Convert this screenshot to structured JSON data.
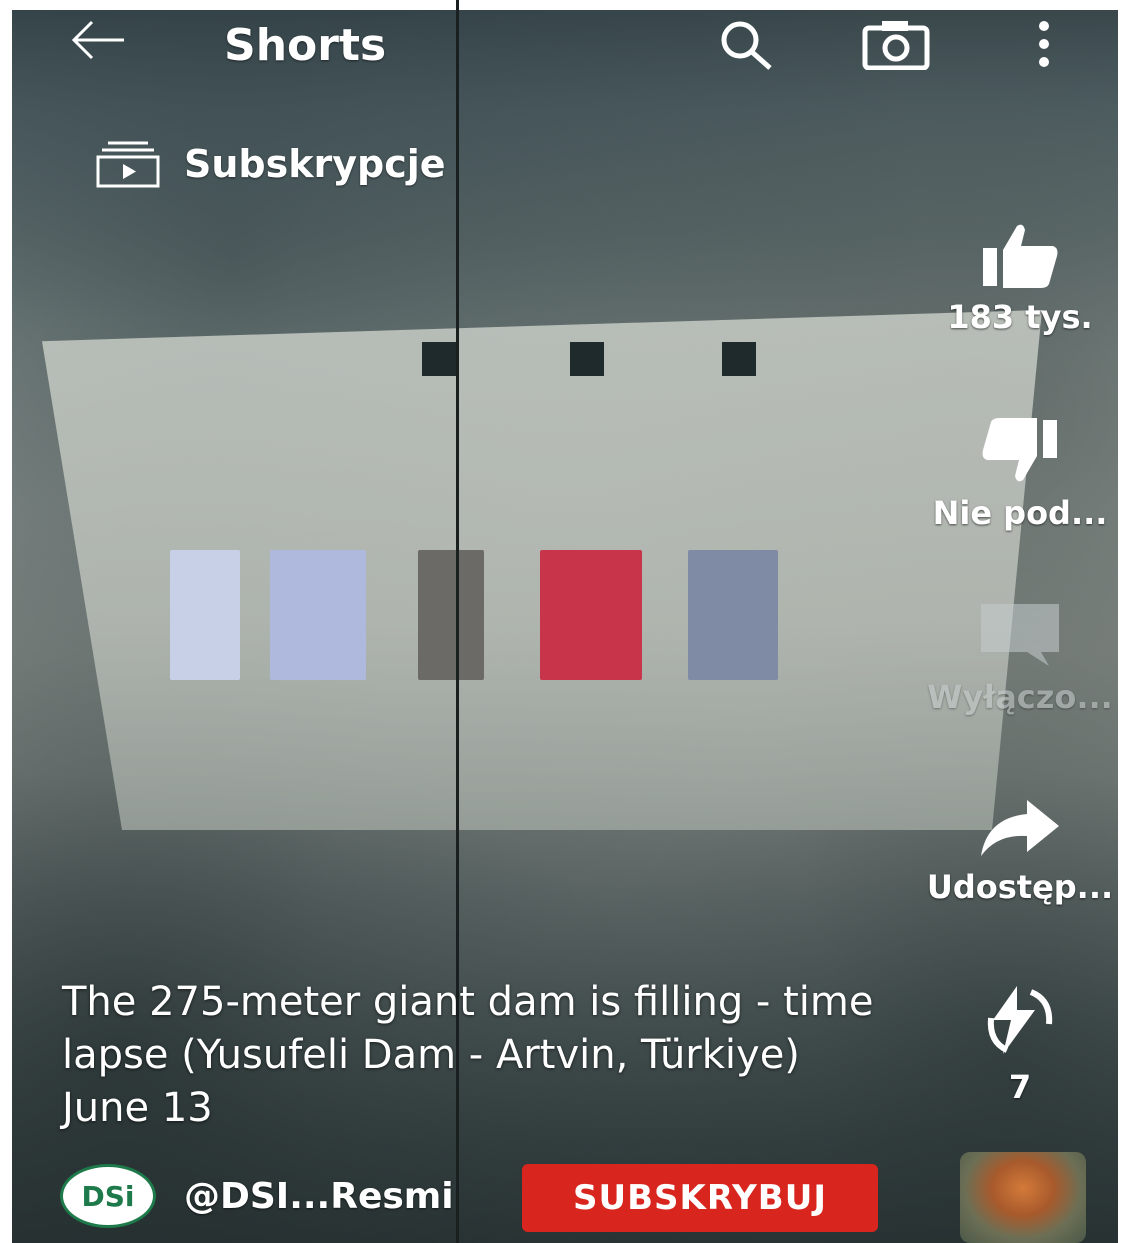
{
  "topbar": {
    "title": "Shorts",
    "back_icon": "arrow-left-icon",
    "search_icon": "search-icon",
    "camera_icon": "camera-icon",
    "more_icon": "more-vertical-icon"
  },
  "subscriptions": {
    "label": "Subskrypcje",
    "icon": "subscriptions-icon"
  },
  "actions": {
    "like": {
      "label": "183 tys.",
      "icon": "thumbs-up-icon"
    },
    "dislike": {
      "label": "Nie pod...",
      "icon": "thumbs-down-icon"
    },
    "comments": {
      "label": "Wyłączo...",
      "icon": "comment-icon"
    },
    "share": {
      "label": "Udostęp...",
      "icon": "share-icon"
    },
    "remix": {
      "label": "7",
      "icon": "remix-icon"
    }
  },
  "video": {
    "caption": "The 275-meter giant dam is filling - time lapse (Yusufeli Dam - Artvin, Türkiye) June 13"
  },
  "channel": {
    "avatar_text": "DSi",
    "handle": "@DSI...Resmi",
    "subscribe_label": "SUBSKRYBUJ"
  },
  "colors": {
    "subscribe": "#d8261f",
    "text": "#ffffff"
  }
}
